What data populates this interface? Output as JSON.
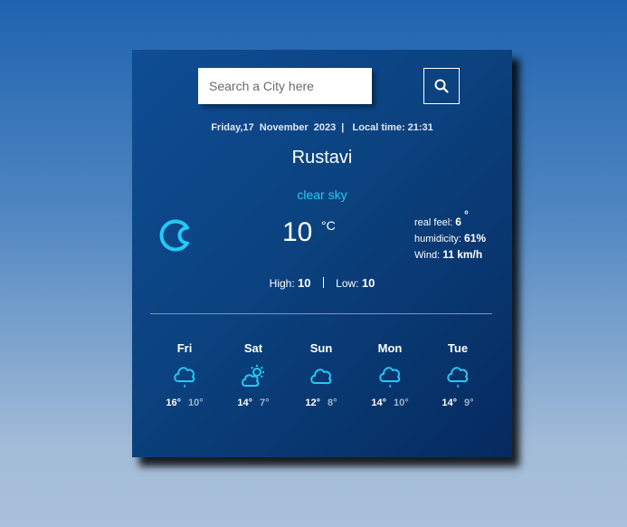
{
  "search": {
    "placeholder": "Search a City here"
  },
  "header": {
    "date_line": "Friday,17  November  2023  |   Local time: 21:31"
  },
  "current": {
    "city": "Rustavi",
    "condition": "clear sky",
    "icon": "moon-icon",
    "temperature": "10",
    "unit": "°C",
    "real_feel_label": "real feel:",
    "real_feel_value": "6",
    "real_feel_degree": "°",
    "humidity_label": "humidicity:",
    "humidity_value": "61%",
    "wind_label": "Wind:",
    "wind_value": "11 km/h",
    "high_label": "High:",
    "high_value": "10",
    "low_label": "Low:",
    "low_value": "10"
  },
  "forecast": [
    {
      "day": "Fri",
      "icon": "light-rain-cloud-icon",
      "high": "16°",
      "low": "10°"
    },
    {
      "day": "Sat",
      "icon": "partly-cloudy-day-icon",
      "high": "14°",
      "low": "7°"
    },
    {
      "day": "Sun",
      "icon": "cloud-icon",
      "high": "12°",
      "low": "8°"
    },
    {
      "day": "Mon",
      "icon": "light-rain-cloud-icon",
      "high": "14°",
      "low": "10°"
    },
    {
      "day": "Tue",
      "icon": "light-rain-cloud-icon",
      "high": "14°",
      "low": "9°"
    }
  ],
  "colors": {
    "accent": "#25c9f5",
    "card": "#0b427f",
    "page_top": "#1f63b0",
    "page_bottom": "#a8c0db"
  }
}
